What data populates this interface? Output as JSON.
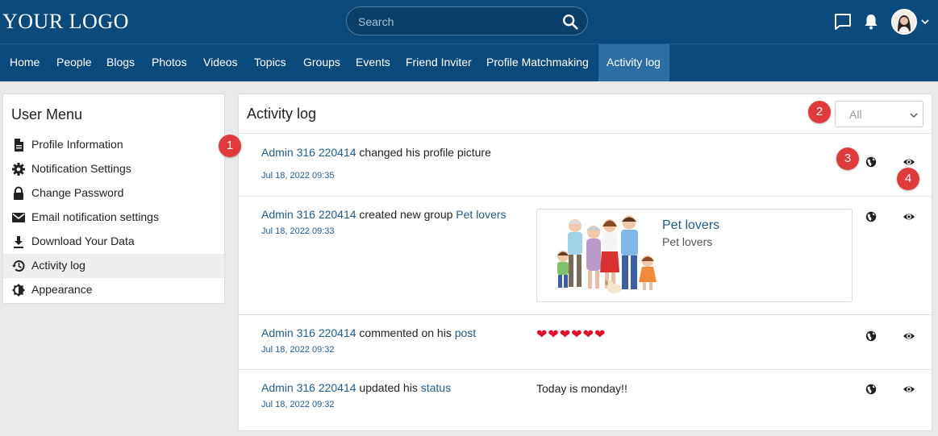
{
  "header": {
    "logo": "YOUR LOGO",
    "search_placeholder": "Search"
  },
  "nav": {
    "items": [
      {
        "label": "Home"
      },
      {
        "label": "People"
      },
      {
        "label": "Blogs"
      },
      {
        "label": "Photos"
      },
      {
        "label": "Videos"
      },
      {
        "label": "Topics"
      },
      {
        "label": "Groups"
      },
      {
        "label": "Events"
      },
      {
        "label": "Friend Inviter"
      },
      {
        "label": "Profile Matchmaking"
      },
      {
        "label": "Activity log"
      }
    ],
    "active": "Activity log"
  },
  "user_menu": {
    "title": "User Menu",
    "items": [
      {
        "label": "Profile Information",
        "icon": "document-icon"
      },
      {
        "label": "Notification Settings",
        "icon": "gear-icon"
      },
      {
        "label": "Change Password",
        "icon": "lock-icon"
      },
      {
        "label": "Email notification settings",
        "icon": "envelope-icon"
      },
      {
        "label": "Download Your Data",
        "icon": "download-icon"
      },
      {
        "label": "Activity log",
        "icon": "history-icon"
      },
      {
        "label": "Appearance",
        "icon": "appearance-icon"
      }
    ]
  },
  "activity": {
    "title": "Activity log",
    "filter_value": "All",
    "entries": [
      {
        "actor": "Admin 316 220414",
        "action": " changed his profile picture",
        "date": "Jul 18, 2022 09:35"
      },
      {
        "actor": "Admin 316 220414",
        "action": " created new group ",
        "link": "Pet lovers",
        "date": "Jul 18, 2022 09:33",
        "card_title": "Pet lovers",
        "card_subtitle": "Pet lovers"
      },
      {
        "actor": "Admin 316 220414",
        "action": " commented on his ",
        "link": "post",
        "date": "Jul 18, 2022 09:32",
        "content": "❤❤❤❤❤❤"
      },
      {
        "actor": "Admin 316 220414",
        "action": " updated his ",
        "link": "status",
        "date": "Jul 18, 2022 09:32",
        "content": "Today is monday!!"
      }
    ]
  },
  "badges": [
    "1",
    "2",
    "3",
    "4"
  ],
  "colors": {
    "header_bg": "#0b4a7c",
    "nav_active": "#2c6fa6",
    "link": "#1f5c8a",
    "badge": "#e03a3a",
    "heart": "#e0102a"
  }
}
